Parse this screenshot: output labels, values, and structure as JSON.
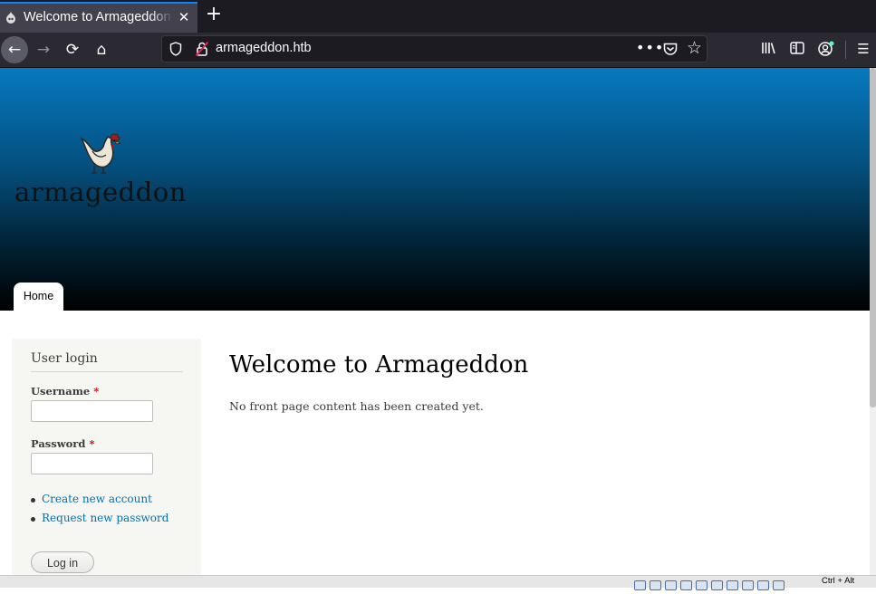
{
  "browser": {
    "tab": {
      "title": "Welcome to Armageddon",
      "favicon": "drupal-favicon",
      "close_glyph": "✕"
    },
    "new_tab_glyph": "+",
    "nav": {
      "back_glyph": "←",
      "forward_glyph": "→",
      "reload_glyph": "⟳",
      "home_glyph": "⌂"
    },
    "url": "armageddon.htb",
    "url_more_glyph": "•••",
    "star_glyph": "☆",
    "toolbar": {
      "library_glyph": "|||\\",
      "sidebar_glyph": "◫",
      "account_glyph": "☺",
      "menu_glyph": "☰"
    }
  },
  "site": {
    "logo_text": "armageddon",
    "nav_tabs": [
      {
        "label": "Home",
        "active": true
      }
    ]
  },
  "login_block": {
    "title": "User login",
    "username_label": "Username",
    "password_label": "Password",
    "required_marker": "*",
    "links": [
      "Create new account",
      "Request new password"
    ],
    "submit_label": "Log in"
  },
  "main": {
    "title": "Welcome to Armageddon",
    "body": "No front page content has been created yet."
  },
  "vm_status": {
    "host_key": "Ctrl + Alt"
  },
  "colors": {
    "header_top": "#0779bf",
    "header_bottom": "#000000",
    "link": "#0071b3",
    "sidebar_bg": "#f6f6f2",
    "required": "#e00000"
  }
}
